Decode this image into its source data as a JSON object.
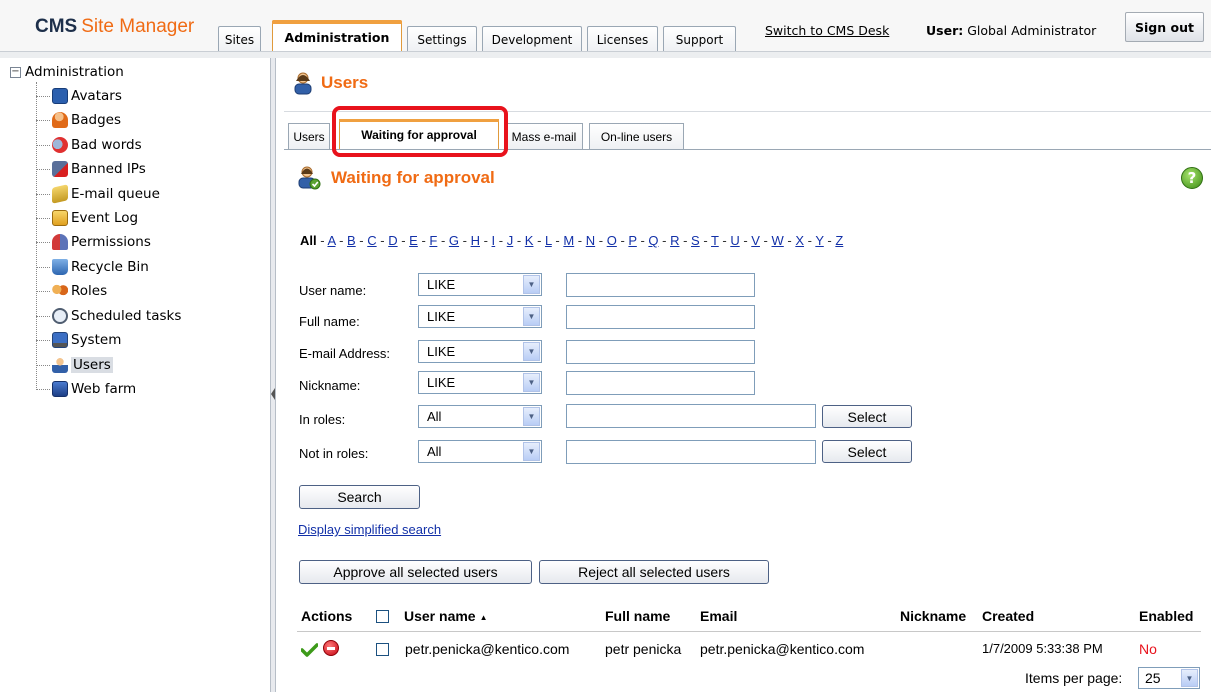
{
  "header": {
    "logo_cms": "CMS",
    "logo_site_manager": "Site Manager",
    "tabs": [
      {
        "label": "Sites"
      },
      {
        "label": "Administration",
        "active": true
      },
      {
        "label": "Settings"
      },
      {
        "label": "Development"
      },
      {
        "label": "Licenses"
      },
      {
        "label": "Support"
      }
    ],
    "switch_link": "Switch to CMS Desk",
    "user_label": "User:",
    "user_name": "Global Administrator",
    "sign_out": "Sign out"
  },
  "tree": {
    "root": "Administration",
    "items": [
      {
        "label": "Avatars",
        "icon": "avatars-icon"
      },
      {
        "label": "Badges",
        "icon": "badges-icon"
      },
      {
        "label": "Bad words",
        "icon": "bad-words-icon"
      },
      {
        "label": "Banned IPs",
        "icon": "banned-ips-icon"
      },
      {
        "label": "E-mail queue",
        "icon": "email-queue-icon"
      },
      {
        "label": "Event Log",
        "icon": "event-log-icon"
      },
      {
        "label": "Permissions",
        "icon": "permissions-icon"
      },
      {
        "label": "Recycle Bin",
        "icon": "recycle-bin-icon"
      },
      {
        "label": "Roles",
        "icon": "roles-icon"
      },
      {
        "label": "Scheduled tasks",
        "icon": "scheduled-tasks-icon"
      },
      {
        "label": "System",
        "icon": "system-icon"
      },
      {
        "label": "Users",
        "icon": "users-icon",
        "selected": true
      },
      {
        "label": "Web farm",
        "icon": "web-farm-icon"
      }
    ]
  },
  "main": {
    "title": "Users",
    "subtabs": [
      {
        "label": "Users"
      },
      {
        "label": "Waiting for approval",
        "active": true
      },
      {
        "label": "Mass e-mail"
      },
      {
        "label": "On-line users"
      }
    ],
    "section_title": "Waiting for approval",
    "help": "?",
    "alphabet": {
      "all": "All",
      "letters": [
        "A",
        "B",
        "C",
        "D",
        "E",
        "F",
        "G",
        "H",
        "I",
        "J",
        "K",
        "L",
        "M",
        "N",
        "O",
        "P",
        "Q",
        "R",
        "S",
        "T",
        "U",
        "V",
        "W",
        "X",
        "Y",
        "Z"
      ]
    },
    "filters": {
      "user_name": {
        "label": "User name:",
        "operator": "LIKE",
        "value": ""
      },
      "full_name": {
        "label": "Full name:",
        "operator": "LIKE",
        "value": ""
      },
      "email": {
        "label": "E-mail Address:",
        "operator": "LIKE",
        "value": ""
      },
      "nickname": {
        "label": "Nickname:",
        "operator": "LIKE",
        "value": ""
      },
      "in_roles": {
        "label": "In roles:",
        "operator": "All",
        "value": "",
        "button": "Select"
      },
      "not_in_roles": {
        "label": "Not in roles:",
        "operator": "All",
        "value": "",
        "button": "Select"
      }
    },
    "search_button": "Search",
    "simplified_link": "Display simplified search",
    "approve_button": "Approve all selected users",
    "reject_button": "Reject all selected users",
    "table": {
      "headers": {
        "actions": "Actions",
        "user_name": "User name",
        "full_name": "Full name",
        "email": "Email",
        "nickname": "Nickname",
        "created": "Created",
        "enabled": "Enabled"
      },
      "rows": [
        {
          "user_name": "petr.penicka@kentico.com",
          "full_name": "petr penicka",
          "email": "petr.penicka@kentico.com",
          "nickname": "",
          "created": "1/7/2009 5:33:38 PM",
          "enabled": "No"
        }
      ]
    },
    "items_per_page_label": "Items per page:",
    "items_per_page": "25"
  },
  "colors": {
    "accent_orange": "#f06b14",
    "link_blue": "#1230a8",
    "highlight_red": "#e8121c",
    "disabled_red": "#e8121c"
  }
}
